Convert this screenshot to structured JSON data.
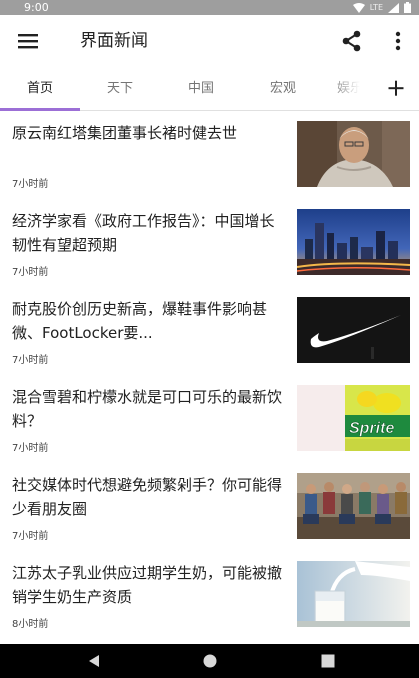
{
  "status_bar": {
    "time": "9:00",
    "network": "LTE"
  },
  "app_bar": {
    "title": "界面新闻",
    "menu_icon": "menu-icon",
    "share_icon": "share-icon",
    "more_icon": "more-vert-icon"
  },
  "tabs": [
    {
      "label": "首页",
      "selected": true
    },
    {
      "label": "天下",
      "selected": false
    },
    {
      "label": "中国",
      "selected": false
    },
    {
      "label": "宏观",
      "selected": false
    },
    {
      "label": "娱乐",
      "selected": false
    }
  ],
  "tab_add_icon": "add-icon",
  "accent_color": "#9c6fd6",
  "news": [
    {
      "title": "原云南红塔集团董事长褚时健去世",
      "time": "7小时前",
      "thumb": "elderly-man-portrait"
    },
    {
      "title": "经济学家看《政府工作报告》：中国增长韧性有望超预期",
      "time": "7小时前",
      "thumb": "city-skyline-night"
    },
    {
      "title": "耐克股价创历史新高，爆鞋事件影响甚微、FootLocker要...",
      "time": "7小时前",
      "thumb": "nike-swoosh-logo"
    },
    {
      "title": "混合雪碧和柠檬水就是可口可乐的最新饮料？",
      "time": "7小时前",
      "thumb": "sprite-can",
      "thumb_text": "Sprite"
    },
    {
      "title": "社交媒体时代想避免频繁剁手？你可能得少看朋友圈",
      "time": "7小时前",
      "thumb": "people-on-phones"
    },
    {
      "title": "江苏太子乳业供应过期学生奶，可能被撤销学生奶生产资质",
      "time": "8小时前",
      "thumb": "milk-pouring"
    }
  ],
  "nav_bar": {
    "back_icon": "back-icon",
    "home_icon": "home-icon",
    "recents_icon": "recents-icon"
  }
}
